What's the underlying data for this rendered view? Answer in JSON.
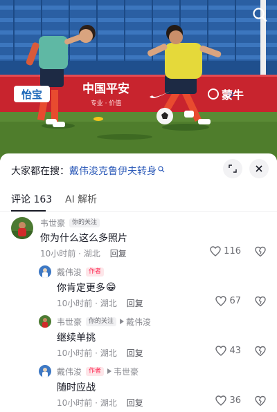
{
  "photo": {
    "sponsor_left": "怡宝",
    "sponsor_main": "中国平安",
    "sponsor_sub": "专业 · 价值",
    "sponsor_right": "蒙牛"
  },
  "search": {
    "prefix": "大家都在搜：",
    "term": "戴伟浚克鲁伊夫转身"
  },
  "tabs": [
    {
      "label": "评论 163"
    },
    {
      "label": "AI 解析"
    }
  ],
  "comments": [
    {
      "author": "韦世豪",
      "badge": "你的关注",
      "text": "你为什么这么多照片",
      "time": "10小时前 · 湖北",
      "reply_label": "回复",
      "likes": "116"
    },
    {
      "author": "戴伟浚",
      "badge": "作者",
      "text": "你肯定更多",
      "emoji": "😁",
      "time": "10小时前 · 湖北",
      "reply_label": "回复",
      "likes": "67"
    },
    {
      "author": "韦世豪",
      "badge": "你的关注",
      "reply_to": "戴伟浚",
      "text": "继续单挑",
      "time": "10小时前 · 湖北",
      "reply_label": "回复",
      "likes": "43"
    },
    {
      "author": "戴伟浚",
      "badge": "作者",
      "reply_to": "韦世豪",
      "text": "随时应战",
      "time": "10小时前 · 湖北",
      "reply_label": "回复",
      "likes": "36"
    }
  ],
  "colors": {
    "accent_red": "#fe2c55",
    "search_link": "#2b59b8",
    "text_muted": "#8a8b91"
  },
  "icons": {
    "photo_search": "search-icon",
    "expand": "expand-icon",
    "close": "close-icon",
    "like": "heart-icon",
    "dislike": "broken-heart-icon",
    "reply_arrow": "triangle-right-icon"
  }
}
